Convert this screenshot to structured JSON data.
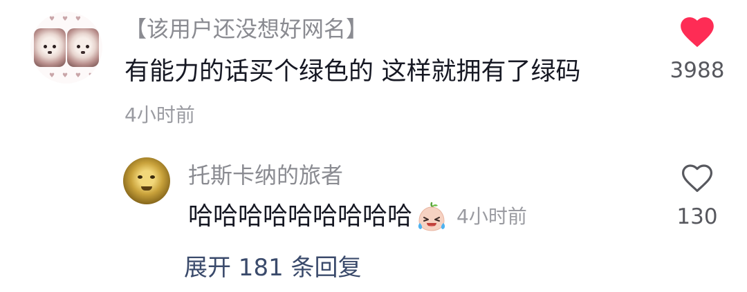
{
  "comment": {
    "username": "【该用户还没想好网名】",
    "content": "有能力的话买个绿色的 这样就拥有了绿码",
    "time": "4小时前",
    "like_count": "3988",
    "liked": true,
    "like_icon": "heart-filled-icon",
    "like_color": "#fe2c55",
    "reply": {
      "username": "托斯卡纳的旅者",
      "content": "哈哈哈哈哈哈哈哈哈",
      "emoji": "laughing-crying-emoji",
      "time": "4小时前",
      "like_count": "130",
      "liked": false,
      "like_icon": "heart-outline-icon"
    },
    "expand_label": "展开 181 条回复"
  },
  "colors": {
    "username": "#8a8b91",
    "content": "#161823",
    "timestamp": "#9a9ba1",
    "count": "#57585e",
    "expand_link": "#3a4a6b"
  }
}
